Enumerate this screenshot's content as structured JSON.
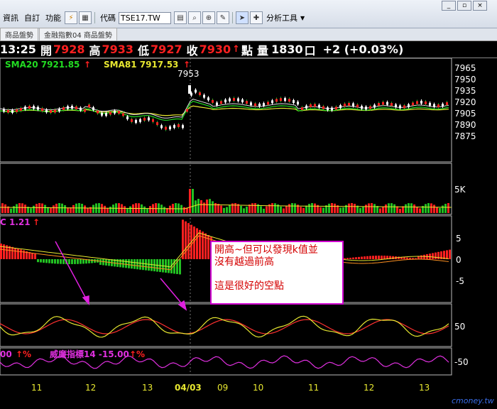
{
  "menubar": {
    "items": [
      "資訊",
      "自訂",
      "功能"
    ],
    "code_label": "代碼",
    "code_value": "TSE17.TW",
    "analysis_label": "分析工具"
  },
  "tabs": [
    "商品盤勢",
    "金融指數04 商品盤勢"
  ],
  "quote": {
    "time": "13:25",
    "open_label": "開",
    "open": "7928",
    "high_label": "高",
    "high": "7933",
    "low_label": "低",
    "low": "7927",
    "close_label": "收",
    "close": "7930",
    "unit_label": "點",
    "vol_label": "量",
    "vol": "1830",
    "vol_unit": "口",
    "change": "+2 (+0.03%)"
  },
  "price_panel": {
    "sma20_label": "SMA20 7921.85",
    "sma81_label": "SMA81 7917.53",
    "peak_label": "7953",
    "ticks": [
      "7965",
      "7950",
      "7935",
      "7920",
      "7905",
      "7890",
      "7875"
    ]
  },
  "volume_panel": {
    "tick": "5K"
  },
  "macd_panel": {
    "label": "C 1.21",
    "ticks": [
      "5",
      "0",
      "-5"
    ]
  },
  "kd_panel": {
    "tick": "50"
  },
  "wr_panel": {
    "left_label": "00",
    "label": "威廉指標14 -15.00",
    "tick": "-50"
  },
  "x_axis": [
    "11",
    "12",
    "13",
    "04/03",
    "09",
    "10",
    "11",
    "12",
    "13"
  ],
  "annotation": {
    "line1": "開高~但可以發現k值並",
    "line2": "沒有越過前高",
    "line3": "",
    "line4": "這是很好的空點"
  },
  "watermark": "cmoney.tw",
  "colors": {
    "up": "#ff2020",
    "down": "#22c022",
    "sma20": "#22dd22",
    "sma81": "#e8e830",
    "annotation_border": "#d000d0"
  }
}
